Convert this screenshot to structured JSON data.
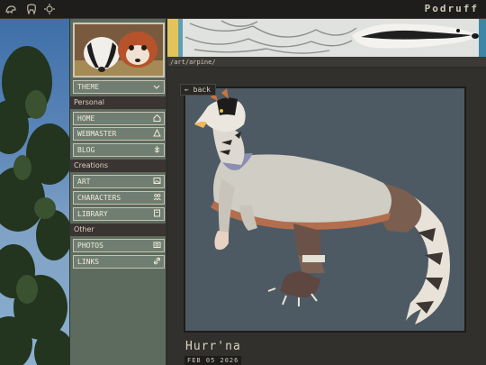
{
  "topbar": {
    "brand": "Podruff",
    "icons": [
      "bird-icon",
      "tooth-icon",
      "sun-icon"
    ]
  },
  "sidebar": {
    "theme_label": "THEME",
    "sections": {
      "personal": "Personal",
      "creations": "Creations",
      "other": "Other"
    },
    "items": [
      {
        "label": "HOME",
        "icon": "home-icon"
      },
      {
        "label": "WEBMASTER",
        "icon": "webmaster-icon"
      },
      {
        "label": "BLOG",
        "icon": "blog-icon"
      },
      {
        "label": "ART",
        "icon": "image-icon"
      },
      {
        "label": "CHARACTERS",
        "icon": "characters-icon"
      },
      {
        "label": "LIBRARY",
        "icon": "library-icon"
      },
      {
        "label": "PHOTOS",
        "icon": "camera-icon"
      },
      {
        "label": "LINKS",
        "icon": "link-icon"
      }
    ]
  },
  "main": {
    "path": "/art/arpine/",
    "back_label": "← back",
    "title": "Hurr'na",
    "date": "FEB 05 2026"
  },
  "colors": {
    "sidebar_bg": "#5c6b5e",
    "button_bg": "#6f7e71",
    "section_bg": "#3a3532",
    "art_bg": "#4e5a63"
  }
}
